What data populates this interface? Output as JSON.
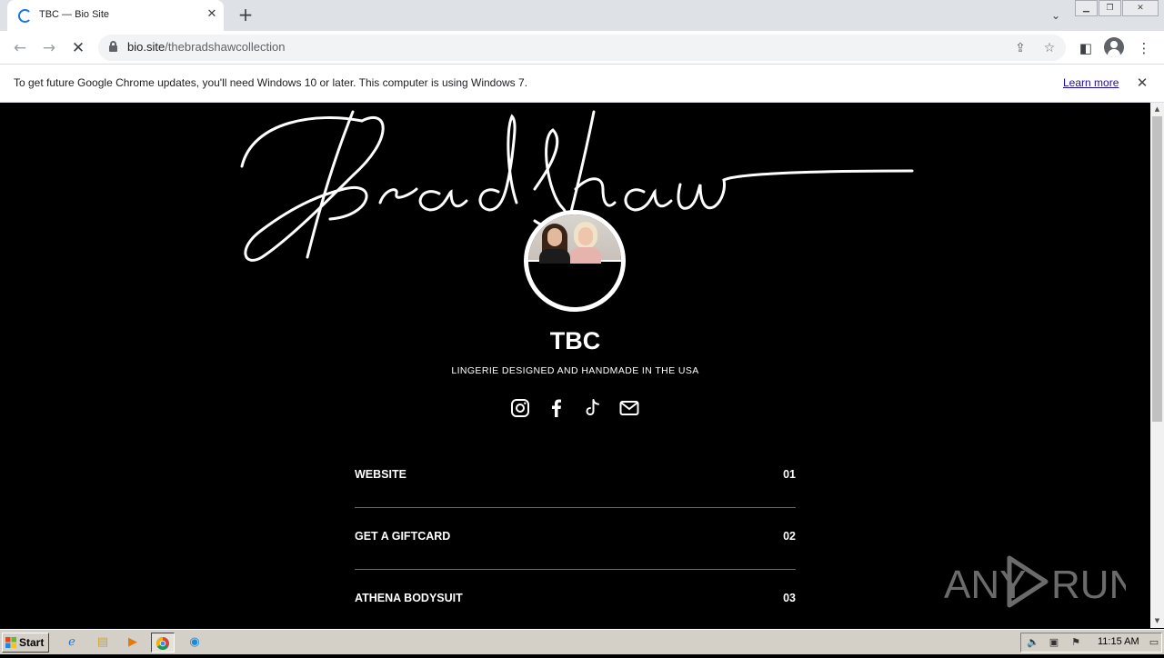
{
  "browser": {
    "tab_title": "TBC — Bio Site",
    "url_host": "bio.site",
    "url_path": "/thebradshawcollection",
    "infobar_message": "To get future Google Chrome updates, you'll need Windows 10 or later. This computer is using Windows 7.",
    "infobar_link": "Learn more"
  },
  "page": {
    "logo_text": "Bradshaw",
    "profile_name": "TBC",
    "bio": "LINGERIE DESIGNED AND HANDMADE IN THE USA",
    "socials": [
      "instagram-icon",
      "facebook-icon",
      "tiktok-icon",
      "email-icon"
    ],
    "links": [
      {
        "label": "WEBSITE",
        "num": "01"
      },
      {
        "label": "GET A GIFTCARD",
        "num": "02"
      },
      {
        "label": "ATHENA BODYSUIT",
        "num": "03"
      }
    ]
  },
  "watermark": "ANY RUN",
  "taskbar": {
    "start_label": "Start",
    "clock": "11:15 AM"
  },
  "colors": {
    "page_bg": "#000000",
    "text": "#ffffff",
    "chrome_blue": "#1a73e8"
  }
}
